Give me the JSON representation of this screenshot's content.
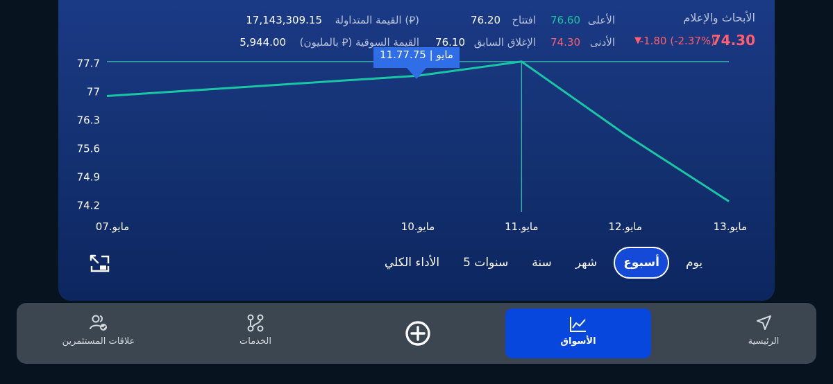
{
  "header": {
    "company_name": "الأبحاث والإعلام",
    "price": "74.30",
    "change_text": "-1.80 (-2.37%)",
    "change_arrow": "▼",
    "high_label": "الأعلى",
    "high_value": "76.60",
    "low_label": "الأدنى",
    "low_value": "74.30",
    "open_label": "افتتاح",
    "open_value": "76.20",
    "prev_close_label": "الإغلاق السابق",
    "prev_close_value": "76.10",
    "traded_value_label": "القيمة المتداولة (⃁)",
    "traded_value": "17,143,309.15",
    "market_value_label": "القيمة السوقية (⃁ بالمليون)",
    "market_value": "5,944.00"
  },
  "tooltip": {
    "text": "11.مايو | 77.75"
  },
  "chart_data": {
    "type": "line",
    "x": [
      "07.مايو",
      "10.مايو",
      "11.مايو",
      "12.مايو",
      "13.مايو"
    ],
    "values": [
      76.9,
      77.4,
      77.75,
      75.95,
      74.3
    ],
    "yticks": [
      "77.7",
      "77",
      "76.3",
      "75.6",
      "74.9",
      "74.2"
    ],
    "ylim": [
      74.0,
      77.9
    ],
    "line_color": "#19c7a4",
    "highlight_index": 2,
    "highlight_value": 77.75
  },
  "ranges": {
    "items": [
      {
        "label": "يوم"
      },
      {
        "label": "أسبوع"
      },
      {
        "label": "شهر"
      },
      {
        "label": "سنة"
      },
      {
        "label": "5 سنوات"
      },
      {
        "label": "الأداء الكلي"
      }
    ],
    "active_index": 1
  },
  "nav": {
    "home": "الرئيسية",
    "markets": "الأسواق",
    "services": "الخدمات",
    "investor_relations": "علاقات المستثمرين"
  },
  "colors": {
    "accent": "#0747dd",
    "positive": "#19c8a0",
    "negative": "#ff5e6c",
    "line": "#19c7a4"
  }
}
